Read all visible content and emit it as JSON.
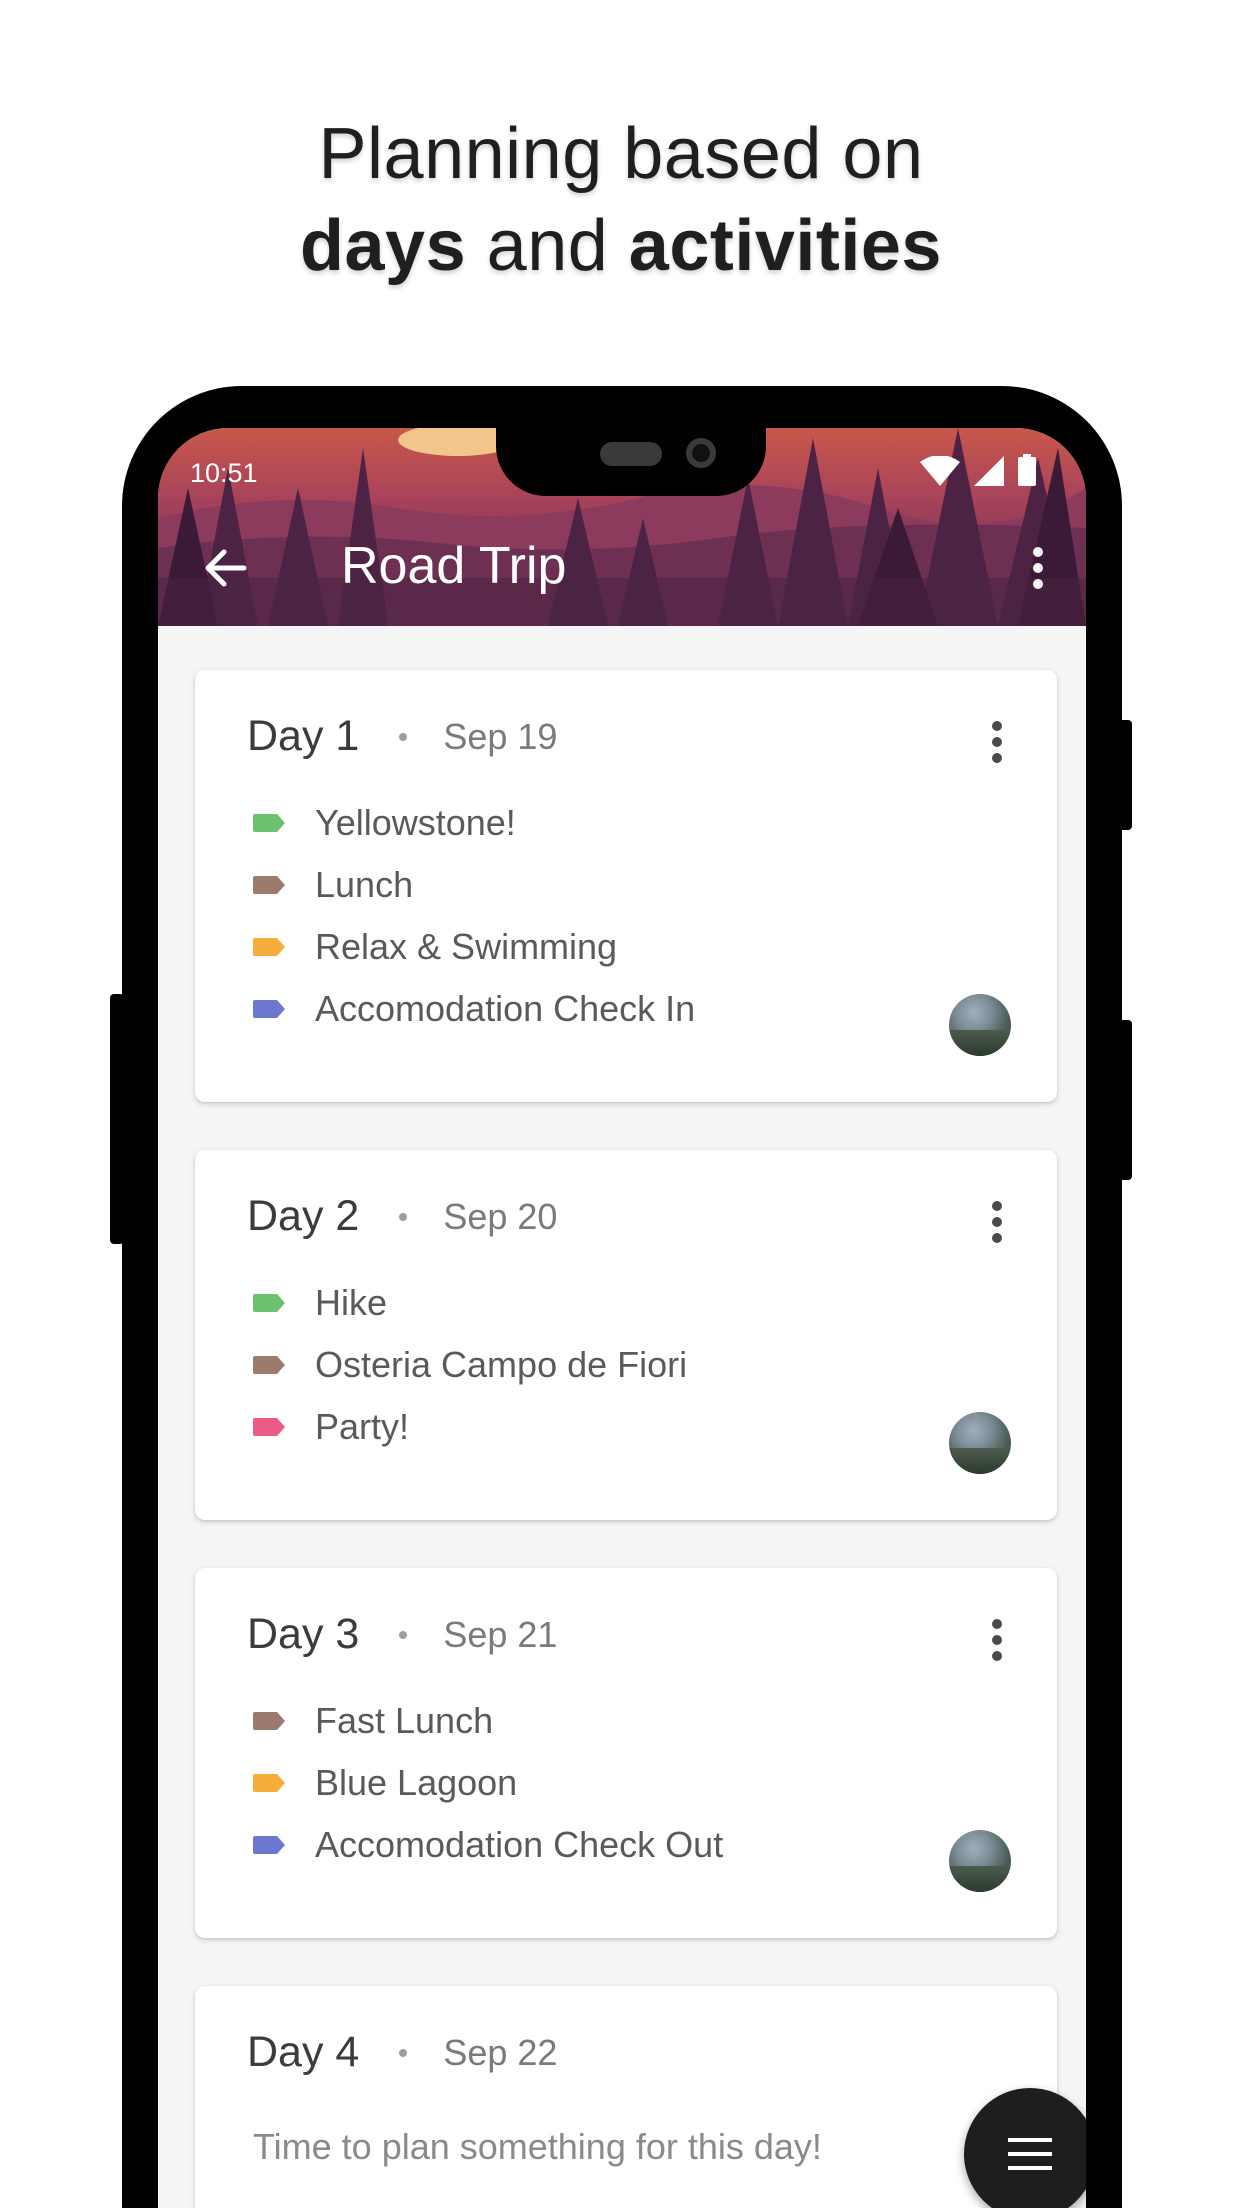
{
  "headline": {
    "line1": "Planning based on",
    "bold1": "days",
    "middle": " and ",
    "bold2": "activities"
  },
  "status_bar": {
    "time": "10:51",
    "icons": [
      "wifi-icon",
      "signal-icon",
      "battery-icon"
    ]
  },
  "app_bar": {
    "title": "Road Trip",
    "back_icon": "arrow-left-icon",
    "menu_icon": "more-vert-icon"
  },
  "colors": {
    "tag_green": "#6cc070",
    "tag_brown": "#9c7a6e",
    "tag_orange": "#f6ad3a",
    "tag_blue": "#6c78d0",
    "tag_pink": "#ec5a86",
    "fab": "#1e1e1e",
    "appbar_purple": "#4a2441"
  },
  "days": [
    {
      "label": "Day 1",
      "date": "Sep 19",
      "activities": [
        {
          "label": "Yellowstone!",
          "color": "#6cc070"
        },
        {
          "label": "Lunch",
          "color": "#9c7a6e"
        },
        {
          "label": "Relax & Swimming",
          "color": "#f6ad3a"
        },
        {
          "label": "Accomodation Check In",
          "color": "#6c78d0"
        }
      ]
    },
    {
      "label": "Day 2",
      "date": "Sep 20",
      "activities": [
        {
          "label": "Hike",
          "color": "#6cc070"
        },
        {
          "label": "Osteria Campo de Fiori",
          "color": "#9c7a6e"
        },
        {
          "label": "Party!",
          "color": "#ec5a86"
        }
      ]
    },
    {
      "label": "Day 3",
      "date": "Sep 21",
      "activities": [
        {
          "label": "Fast Lunch",
          "color": "#9c7a6e"
        },
        {
          "label": "Blue Lagoon",
          "color": "#f6ad3a"
        },
        {
          "label": "Accomodation Check Out",
          "color": "#6c78d0"
        }
      ]
    },
    {
      "label": "Day 4",
      "date": "Sep 22",
      "empty_message": "Time to plan something for this day!"
    }
  ],
  "fab": {
    "icon": "menu-icon"
  }
}
